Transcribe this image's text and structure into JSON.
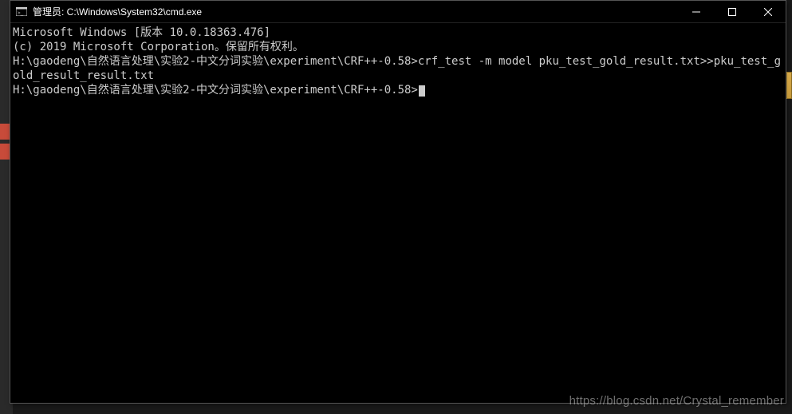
{
  "titlebar": {
    "title": "管理员: C:\\Windows\\System32\\cmd.exe"
  },
  "terminal": {
    "line1": "Microsoft Windows [版本 10.0.18363.476]",
    "line2": "(c) 2019 Microsoft Corporation。保留所有权利。",
    "blank1": "",
    "prompt1": "H:\\gaodeng\\自然语言处理\\实验2-中文分词实验\\experiment\\CRF++-0.58>",
    "command1": "crf_test -m model pku_test_gold_result.txt>>pku_test_gold_result_result.txt",
    "blank2": "",
    "prompt2": "H:\\gaodeng\\自然语言处理\\实验2-中文分词实验\\experiment\\CRF++-0.58>"
  },
  "watermark": "https://blog.csdn.net/Crystal_remember"
}
